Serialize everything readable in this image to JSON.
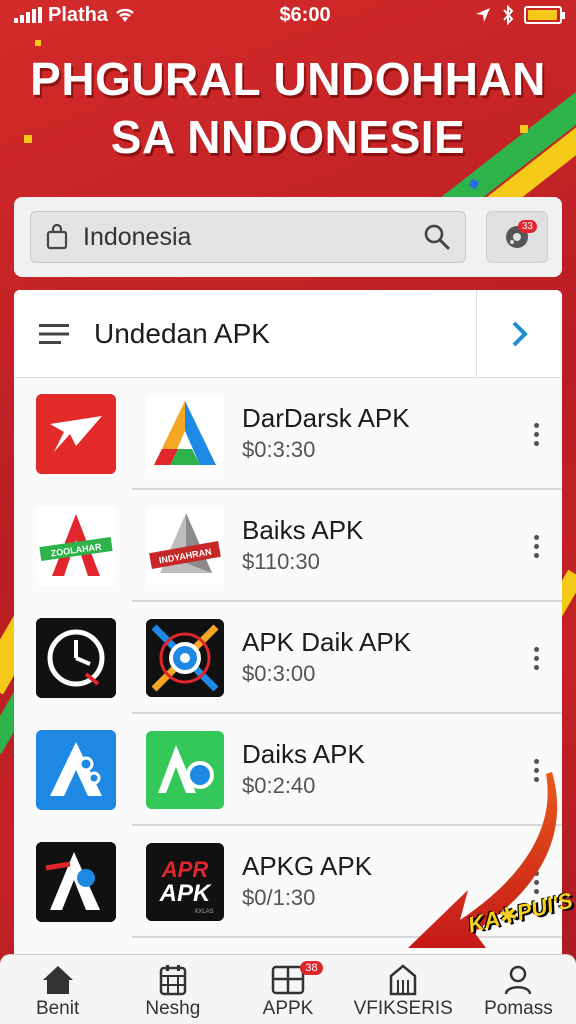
{
  "status_bar": {
    "carrier": "Platha",
    "time": "$6:00",
    "battery_level": 0.95
  },
  "headline": {
    "line1": "PHGURAL UNDOHHAN",
    "line2": "SA NNDONESIE"
  },
  "search": {
    "value": "Indonesia",
    "settings_badge": "33"
  },
  "list": {
    "title": "Undedan APK",
    "items": [
      {
        "name": "DarDarsk APK",
        "price": "$0:3:30"
      },
      {
        "name": "Baiks APK",
        "price": "$110:30"
      },
      {
        "name": "APK Daik APK",
        "price": "$0:3:00"
      },
      {
        "name": "Daiks APK",
        "price": "$0:2:40"
      },
      {
        "name": "APKG APK",
        "price": "$0/1:30"
      }
    ]
  },
  "thumb_texts": {
    "baiks_left": "ZOOLAHAR",
    "baiks_right": "INDYAHRAN",
    "apkg_line1": "APR",
    "apkg_line2": "APK",
    "apkg_line3": "XXLAS"
  },
  "sticker": "KA✱PUI'S",
  "bottom_nav": {
    "items": [
      {
        "label": "Benit",
        "icon": "home-icon"
      },
      {
        "label": "Neshg",
        "icon": "calendar-icon"
      },
      {
        "label": "APPK",
        "icon": "window-icon",
        "badge": "38"
      },
      {
        "label": "VFIKSERIS",
        "icon": "building-icon"
      },
      {
        "label": "Pomass",
        "icon": "person-icon"
      }
    ]
  },
  "colors": {
    "background": "#c42226",
    "accent_red": "#e0262c",
    "accent_yellow": "#f4c918",
    "accent_green": "#2db34a",
    "link_blue": "#1a8fd6"
  }
}
